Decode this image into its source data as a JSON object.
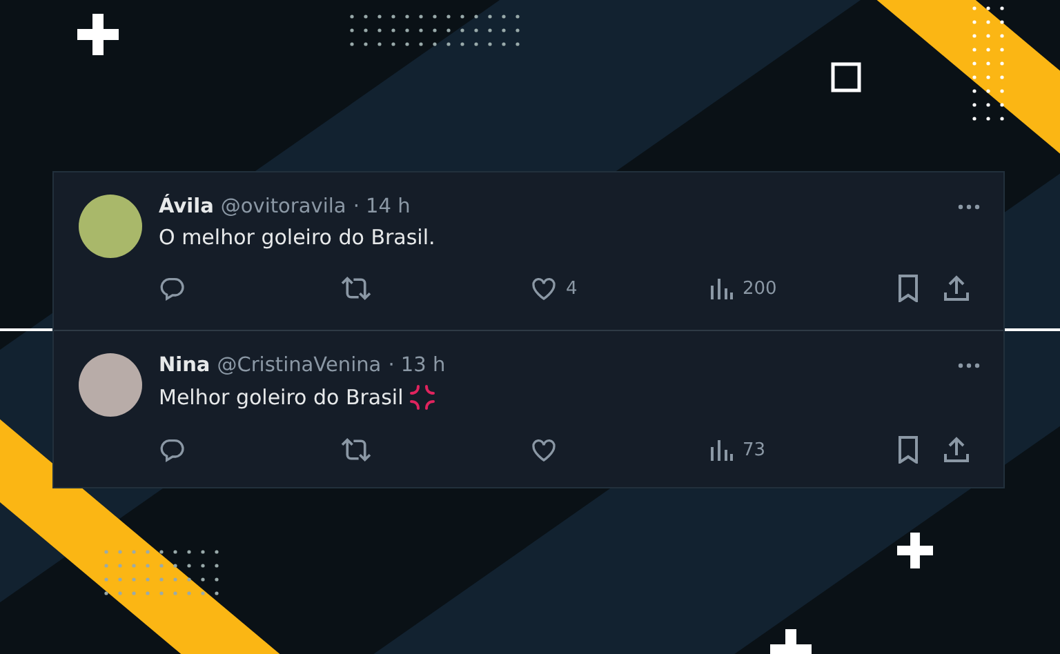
{
  "tweets": [
    {
      "name": "Ávila",
      "handle": "@ovitoravila",
      "time": "· 14 h",
      "text": "O melhor goleiro do Brasil.",
      "kind": "plain",
      "likes": "4",
      "views": "200"
    },
    {
      "name": "Nina",
      "handle": "@CristinaVenina",
      "time": "· 13 h",
      "text": "Melhor goleiro do Brasil",
      "kind": "emoji",
      "views": "73"
    }
  ]
}
